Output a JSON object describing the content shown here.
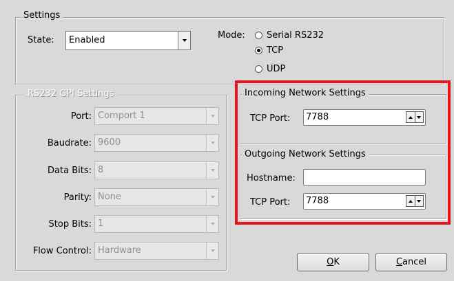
{
  "settings": {
    "title": "Settings",
    "state_label": "State:",
    "state_value": "Enabled",
    "mode_label": "Mode:",
    "mode_options": [
      {
        "label": "Serial RS232",
        "selected": false
      },
      {
        "label": "TCP",
        "selected": true
      },
      {
        "label": "UDP",
        "selected": false
      }
    ]
  },
  "rs232": {
    "title": "RS232 GPI Settings",
    "fields": [
      {
        "label": "Port:",
        "value": "Comport 1"
      },
      {
        "label": "Baudrate:",
        "value": "9600"
      },
      {
        "label": "Data Bits:",
        "value": "8"
      },
      {
        "label": "Parity:",
        "value": "None"
      },
      {
        "label": "Stop Bits:",
        "value": "1"
      },
      {
        "label": "Flow Control:",
        "value": "Hardware"
      }
    ]
  },
  "incoming": {
    "title": "Incoming Network Settings",
    "tcp_port_label": "TCP Port:",
    "tcp_port_value": "7788"
  },
  "outgoing": {
    "title": "Outgoing Network Settings",
    "hostname_label": "Hostname:",
    "hostname_value": "",
    "tcp_port_label": "TCP Port:",
    "tcp_port_value": "7788"
  },
  "buttons": {
    "ok_mnemonic": "O",
    "ok_rest": "K",
    "cancel_mnemonic": "C",
    "cancel_rest": "ancel"
  },
  "colors": {
    "highlight": "#e3161e",
    "background": "#d9d9d9"
  }
}
